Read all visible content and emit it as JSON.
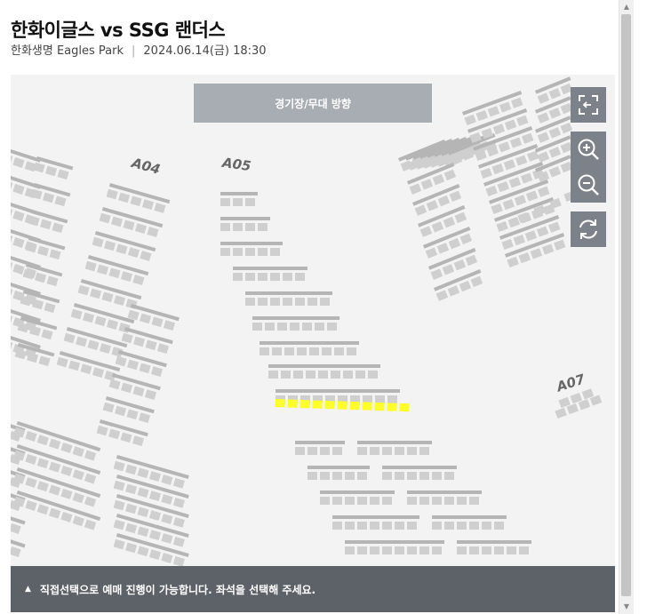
{
  "header": {
    "title": "한화이글스 vs SSG 랜더스",
    "venue": "한화생명 Eagles Park",
    "datetime": "2024.06.14(금) 18:30"
  },
  "map": {
    "stage_label": "경기장/무대 방향",
    "zones": [
      "A04",
      "A05",
      "A07"
    ],
    "highlight_color": "#ffff2a",
    "seat_color": "#cfcfcf",
    "bar_color": "#b5b5b5"
  },
  "controls": {
    "fit_icon": "fit-screen-icon",
    "zoom_in_icon": "zoom-in-icon",
    "zoom_out_icon": "zoom-out-icon",
    "refresh_icon": "refresh-icon"
  },
  "notice": {
    "text": "직접선택으로 예매 진행이 가능합니다. 좌석을 선택해 주세요."
  }
}
